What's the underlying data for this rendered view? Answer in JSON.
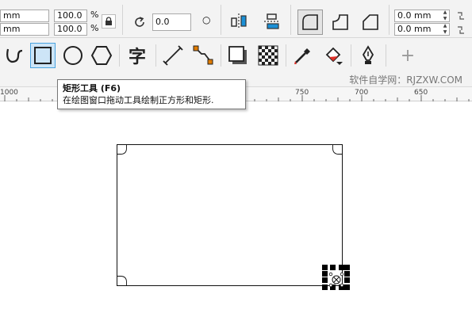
{
  "property_bar": {
    "size_unit_1": "mm",
    "size_unit_2": "mm",
    "scale_x": "100.0",
    "scale_y": "100.0",
    "percent_symbol": "%",
    "rotation": "0.0",
    "degree_symbol": "○",
    "corner_radius_1": "0.0 mm",
    "corner_radius_2": "0.0 mm"
  },
  "toolbar": {
    "text_tool_glyph": "字",
    "plus_glyph": "+"
  },
  "tooltip": {
    "title": "矩形工具 (F6)",
    "description": "在绘图窗口拖动工具绘制正方形和矩形."
  },
  "watermark": "软件自学网：RJZXW.COM",
  "ruler": {
    "labels": [
      "1000",
      "750",
      "700",
      "650"
    ]
  },
  "colors": {
    "accent_blue": "#1a8fd6",
    "accent_orange": "#e07b00",
    "selection_border": "#4aa3df"
  }
}
